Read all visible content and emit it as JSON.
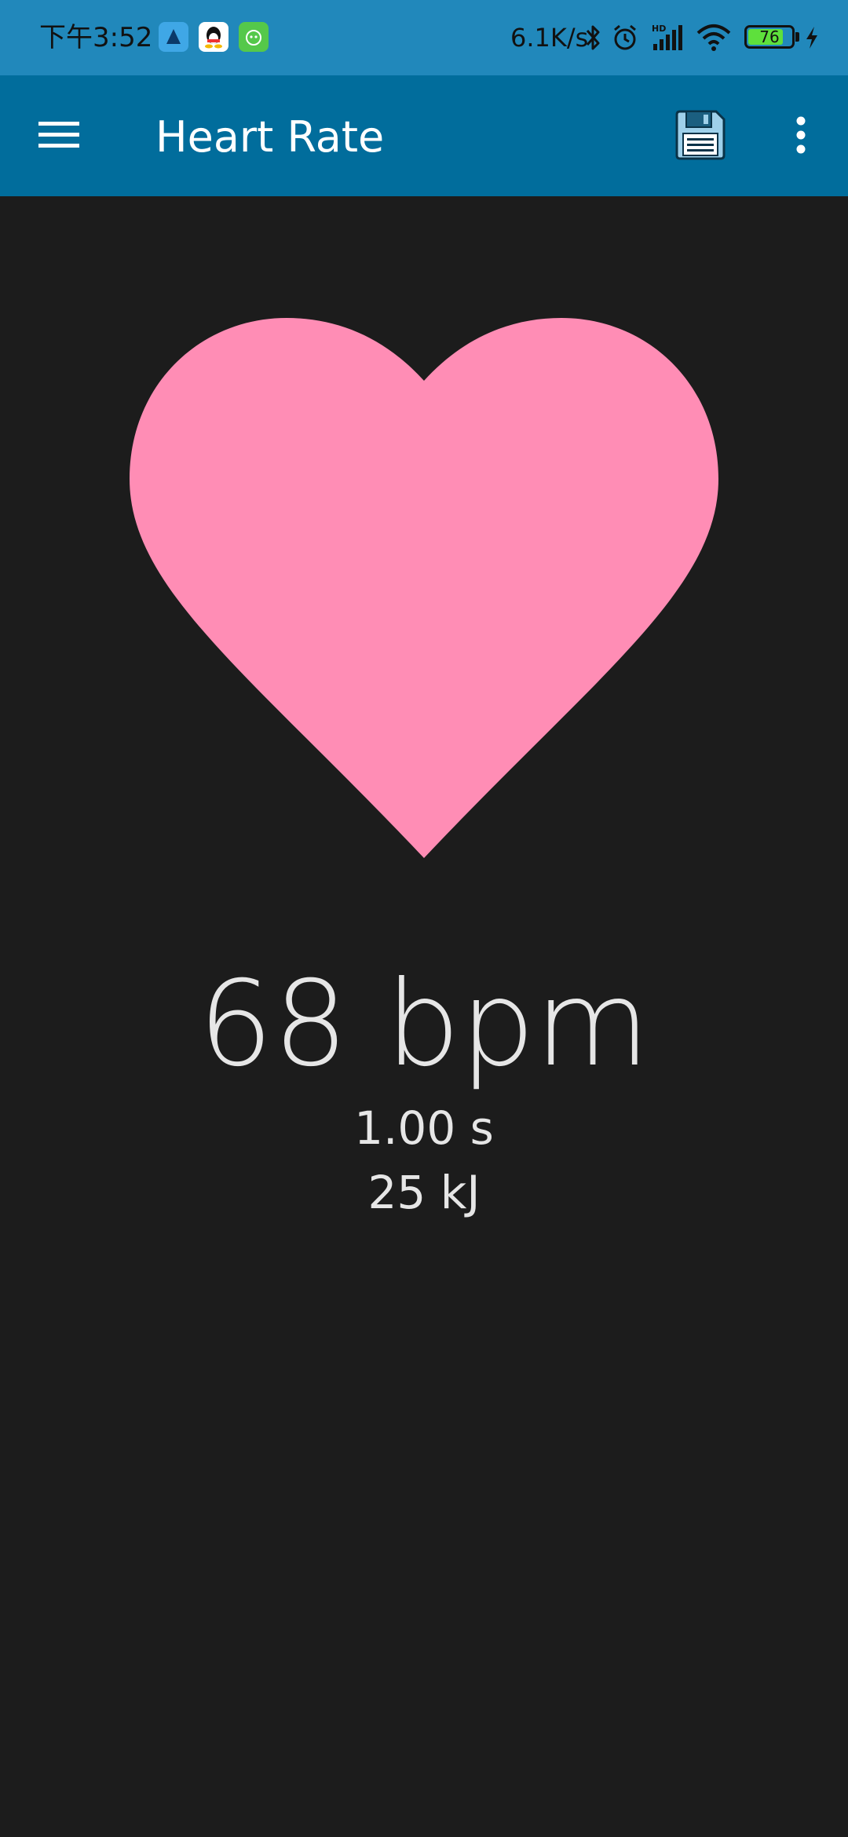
{
  "status_bar": {
    "time": "下午3:52",
    "network_speed": "6.1K/s",
    "battery_level": "76",
    "apps": [
      "app-icon-1",
      "qq-icon",
      "app-icon-3"
    ],
    "indicators": [
      "bluetooth-icon",
      "alarm-icon",
      "hd-signal-icon",
      "wifi-icon",
      "charging-icon"
    ]
  },
  "app_bar": {
    "title": "Heart Rate",
    "menu_icon": "hamburger-menu-icon",
    "save_icon": "floppy-disk-icon",
    "more_icon": "more-vertical-icon"
  },
  "heart": {
    "icon": "heart-icon",
    "color": "#ff8db5"
  },
  "readouts": {
    "bpm": "68 bpm",
    "interval": "1.00 s",
    "energy": "25 kJ"
  },
  "colors": {
    "status_bar": "#2188bb",
    "app_bar": "#016d9c",
    "background": "#1c1c1c",
    "text": "#e6e6e6"
  }
}
